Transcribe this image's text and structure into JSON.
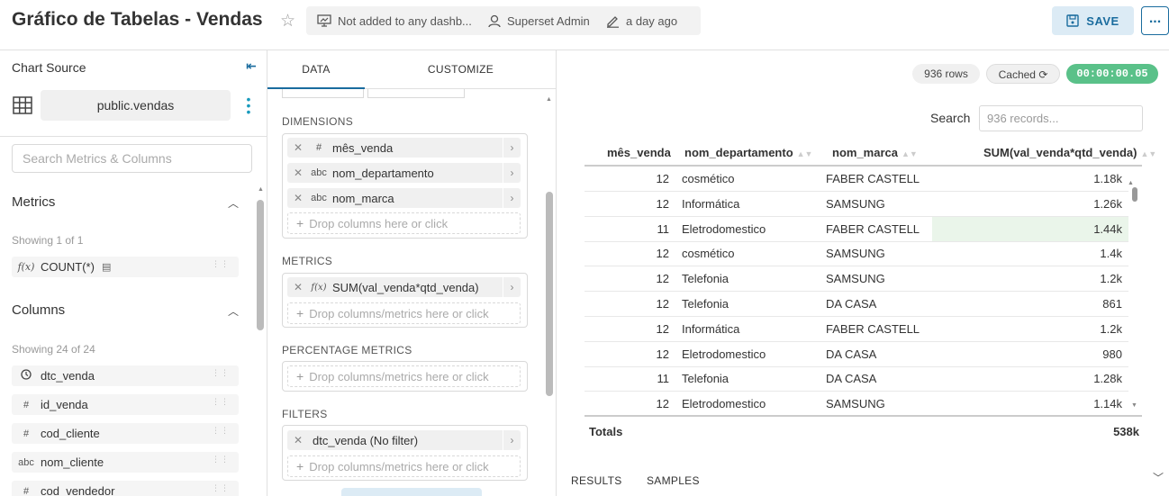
{
  "header": {
    "title": "Gráfico de Tabelas - Vendas",
    "dashboards": "Not added to any dashb...",
    "owner": "Superset Admin",
    "modified": "a day ago",
    "save_label": "SAVE",
    "more_label": "..."
  },
  "left": {
    "chart_source_label": "Chart Source",
    "datasource": "public.vendas",
    "search_placeholder": "Search Metrics & Columns",
    "metrics_label": "Metrics",
    "metrics_showing": "Showing 1 of 1",
    "metrics": [
      {
        "type": "f(x)",
        "name": "COUNT(*)"
      }
    ],
    "columns_label": "Columns",
    "columns_showing": "Showing 24 of 24",
    "columns": [
      {
        "type": "clock",
        "name": "dtc_venda"
      },
      {
        "type": "#",
        "name": "id_venda"
      },
      {
        "type": "#",
        "name": "cod_cliente"
      },
      {
        "type": "abc",
        "name": "nom_cliente"
      },
      {
        "type": "#",
        "name": "cod_vendedor"
      }
    ]
  },
  "mid": {
    "tabs": [
      "DATA",
      "CUSTOMIZE"
    ],
    "dimensions_label": "DIMENSIONS",
    "dimensions": [
      {
        "type": "#",
        "name": "mês_venda"
      },
      {
        "type": "abc",
        "name": "nom_departamento"
      },
      {
        "type": "abc",
        "name": "nom_marca"
      }
    ],
    "drop_columns": "Drop columns here or click",
    "metrics_label": "METRICS",
    "metrics": [
      {
        "type": "f(x)",
        "name": "SUM(val_venda*qtd_venda)"
      }
    ],
    "drop_metrics": "Drop columns/metrics here or click",
    "percentage_label": "PERCENTAGE METRICS",
    "drop_percentage": "Drop columns/metrics here or click",
    "filters_label": "FILTERS",
    "filters": [
      {
        "name": "dtc_venda (No filter)"
      }
    ],
    "drop_filters": "Drop columns/metrics here or click"
  },
  "right": {
    "rows_badge": "936 rows",
    "cached_badge": "Cached",
    "timer_badge": "00:00:00.05",
    "search_label": "Search",
    "search_placeholder": "936 records...",
    "columns": [
      "mês_venda",
      "nom_departamento",
      "nom_marca",
      "SUM(val_venda*qtd_venda)"
    ],
    "rows": [
      {
        "mes": "12",
        "dep": "cosmético",
        "marca": "FABER CASTELL",
        "sum": "1.18k",
        "value": 1180
      },
      {
        "mes": "12",
        "dep": "Informática",
        "marca": "SAMSUNG",
        "sum": "1.26k",
        "value": 1260
      },
      {
        "mes": "11",
        "dep": "Eletrodomestico",
        "marca": "FABER CASTELL",
        "sum": "1.44k",
        "value": 1440
      },
      {
        "mes": "12",
        "dep": "cosmético",
        "marca": "SAMSUNG",
        "sum": "1.4k",
        "value": 1400
      },
      {
        "mes": "12",
        "dep": "Telefonia",
        "marca": "SAMSUNG",
        "sum": "1.2k",
        "value": 1200
      },
      {
        "mes": "12",
        "dep": "Telefonia",
        "marca": "DA CASA",
        "sum": "861",
        "value": 861
      },
      {
        "mes": "12",
        "dep": "Informática",
        "marca": "FABER CASTELL",
        "sum": "1.2k",
        "value": 1200
      },
      {
        "mes": "12",
        "dep": "Eletrodomestico",
        "marca": "DA CASA",
        "sum": "980",
        "value": 980
      },
      {
        "mes": "11",
        "dep": "Telefonia",
        "marca": "DA CASA",
        "sum": "1.28k",
        "value": 1280
      },
      {
        "mes": "12",
        "dep": "Eletrodomestico",
        "marca": "SAMSUNG",
        "sum": "1.14k",
        "value": 1140
      }
    ],
    "totals_label": "Totals",
    "totals_value": "538k",
    "bottom_tabs": [
      "RESULTS",
      "SAMPLES"
    ]
  },
  "colors": {
    "accent": "#1a6c9e",
    "timer": "#5ac189",
    "bar": "#eaf5ea"
  }
}
